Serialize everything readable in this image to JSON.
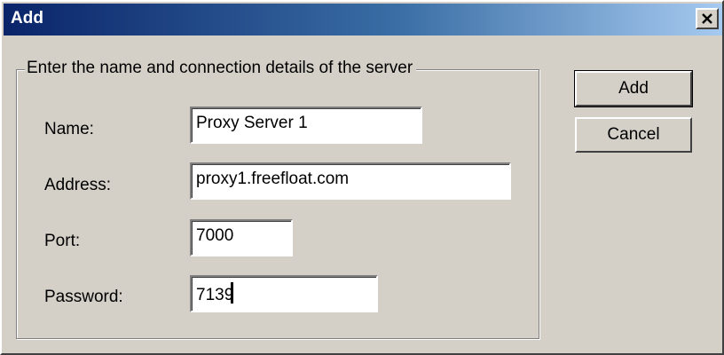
{
  "window": {
    "title": "Add"
  },
  "group": {
    "legend": "Enter the name and connection details of the server"
  },
  "fields": {
    "name": {
      "label": "Name:",
      "value": "Proxy Server 1"
    },
    "address": {
      "label": "Address:",
      "value": "proxy1.freefloat.com"
    },
    "port": {
      "label": "Port:",
      "value": "7000"
    },
    "password": {
      "label": "Password:",
      "value": "7139"
    }
  },
  "buttons": {
    "add": "Add",
    "cancel": "Cancel"
  },
  "icons": {
    "close": "close-icon"
  },
  "colors": {
    "titlebar_start": "#0a246a",
    "titlebar_end": "#a6caf0",
    "face": "#d4d0c8"
  }
}
